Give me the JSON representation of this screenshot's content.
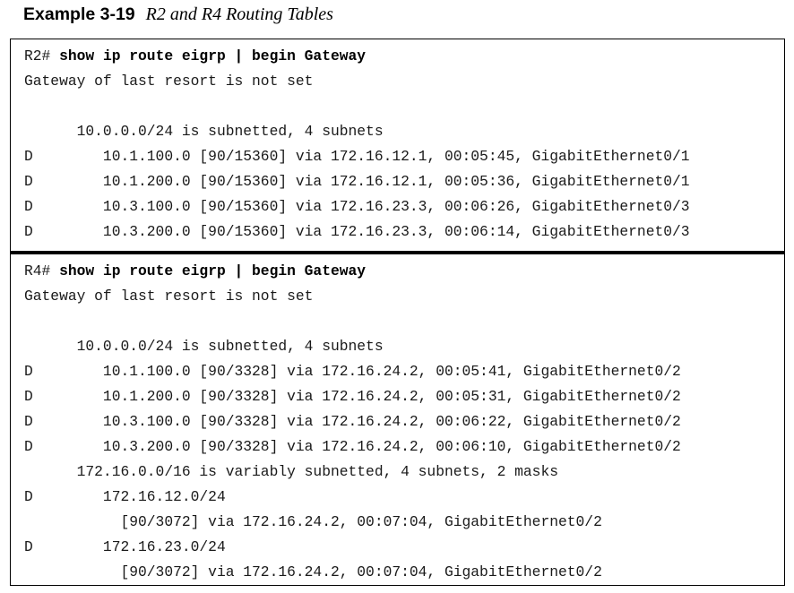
{
  "caption": {
    "number": "Example 3-19",
    "title": "R2 and R4 Routing Tables"
  },
  "r2": {
    "prompt": "R2#",
    "command": "show ip route eigrp | begin Gateway",
    "lines": [
      "Gateway of last resort is not set",
      "",
      "      10.0.0.0/24 is subnetted, 4 subnets",
      "D        10.1.100.0 [90/15360] via 172.16.12.1, 00:05:45, GigabitEthernet0/1",
      "D        10.1.200.0 [90/15360] via 172.16.12.1, 00:05:36, GigabitEthernet0/1",
      "D        10.3.100.0 [90/15360] via 172.16.23.3, 00:06:26, GigabitEthernet0/3",
      "D        10.3.200.0 [90/15360] via 172.16.23.3, 00:06:14, GigabitEthernet0/3"
    ]
  },
  "r4": {
    "prompt": "R4#",
    "command": "show ip route eigrp | begin Gateway",
    "lines": [
      "Gateway of last resort is not set",
      "",
      "      10.0.0.0/24 is subnetted, 4 subnets",
      "D        10.1.100.0 [90/3328] via 172.16.24.2, 00:05:41, GigabitEthernet0/2",
      "D        10.1.200.0 [90/3328] via 172.16.24.2, 00:05:31, GigabitEthernet0/2",
      "D        10.3.100.0 [90/3328] via 172.16.24.2, 00:06:22, GigabitEthernet0/2",
      "D        10.3.200.0 [90/3328] via 172.16.24.2, 00:06:10, GigabitEthernet0/2",
      "      172.16.0.0/16 is variably subnetted, 4 subnets, 2 masks",
      "D        172.16.12.0/24",
      "           [90/3072] via 172.16.24.2, 00:07:04, GigabitEthernet0/2",
      "D        172.16.23.0/24",
      "           [90/3072] via 172.16.24.2, 00:07:04, GigabitEthernet0/2"
    ]
  }
}
